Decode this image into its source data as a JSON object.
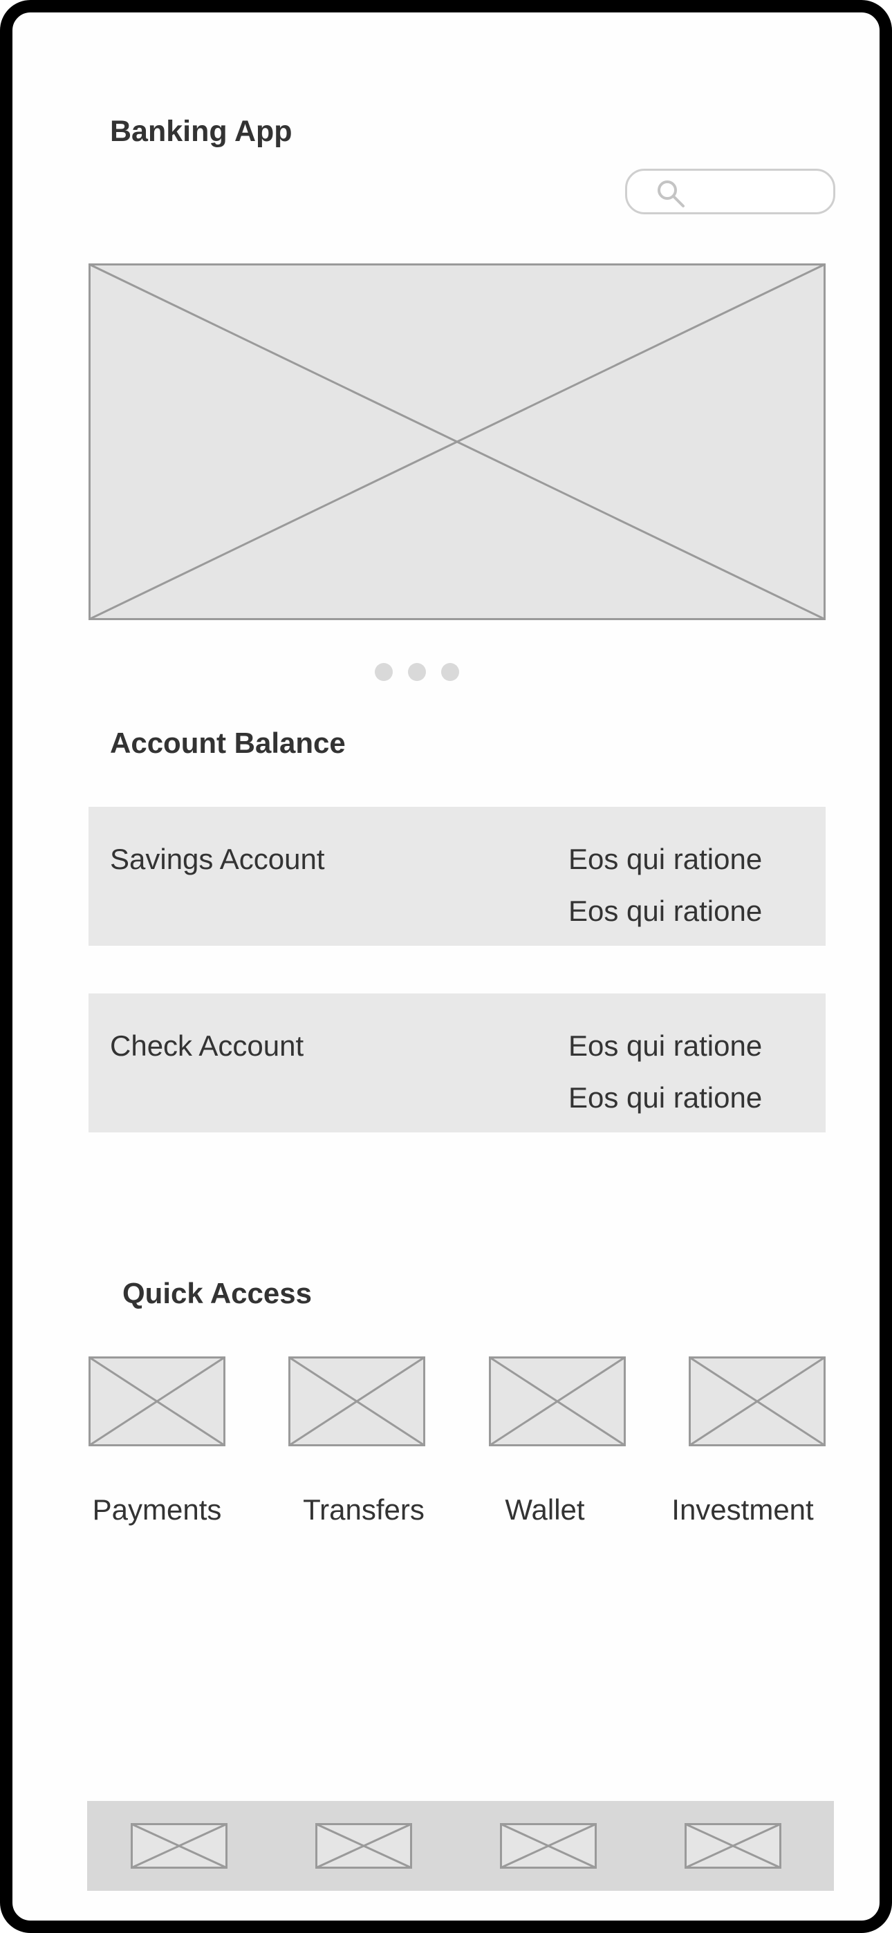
{
  "app": {
    "title": "Banking App"
  },
  "search": {
    "placeholder": "",
    "icon": "search-icon"
  },
  "carousel": {
    "slide_count": 3,
    "active_index": 0
  },
  "account_balance": {
    "title": "Account Balance",
    "accounts": [
      {
        "name": "Savings Account",
        "lines": [
          "Eos qui ratione",
          "Eos qui ratione"
        ]
      },
      {
        "name": "Check Account",
        "lines": [
          "Eos qui ratione",
          "Eos qui ratione"
        ]
      }
    ]
  },
  "quick_access": {
    "title": "Quick Access",
    "items": [
      {
        "label": "Payments"
      },
      {
        "label": "Transfers"
      },
      {
        "label": "Wallet"
      },
      {
        "label": "Investment"
      }
    ]
  },
  "bottom_nav": {
    "item_count": 4
  },
  "colors": {
    "frame": "#000000",
    "text": "#333333",
    "placeholder_fill": "#e5e5e5",
    "placeholder_stroke": "#9a9a9a",
    "card_fill": "#e8e8e8",
    "bottom_bar": "#d8d8d8",
    "dot": "#d9d9d9"
  }
}
